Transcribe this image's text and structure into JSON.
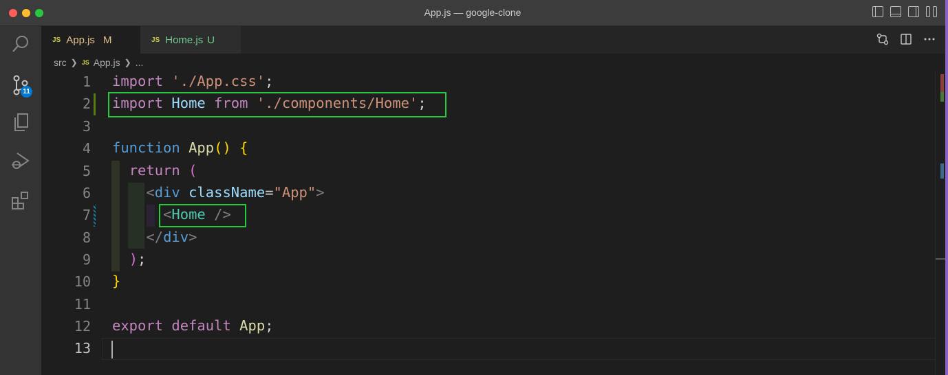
{
  "window": {
    "title": "App.js — google-clone"
  },
  "activity_bar": {
    "source_control_badge": "11"
  },
  "tabs": [
    {
      "icon": "JS",
      "name": "App.js",
      "status": "M"
    },
    {
      "icon": "JS",
      "name": "Home.js",
      "status": "U"
    }
  ],
  "breadcrumb": {
    "folder": "src",
    "file_icon": "JS",
    "file": "App.js",
    "more": "..."
  },
  "editor": {
    "line_numbers": [
      "1",
      "2",
      "3",
      "4",
      "5",
      "6",
      "7",
      "8",
      "9",
      "10",
      "11",
      "12",
      "13"
    ],
    "lines": [
      "import './App.css';",
      "import Home from './components/Home';",
      "",
      "function App() {",
      "  return (",
      "    <div className=\"App\">",
      "      <Home />",
      "    </div>",
      "  );",
      "}",
      "",
      "export default App;",
      ""
    ]
  },
  "colors": {
    "highlight_box": "#27c93f",
    "keyword": "#c586c0",
    "string": "#ce9178",
    "component": "#4ec9b0"
  }
}
